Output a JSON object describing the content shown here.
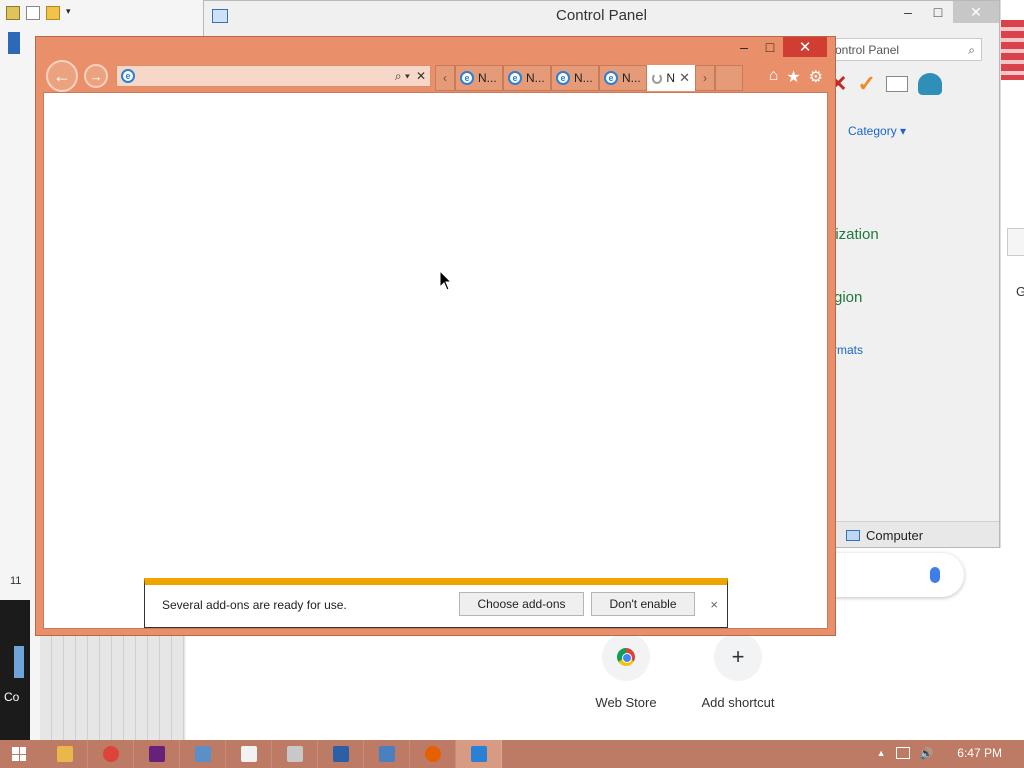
{
  "explorer": {
    "side_number": "11",
    "side_label": "Co"
  },
  "control_panel": {
    "title": "Control Panel",
    "search_placeholder": "ontrol Panel",
    "view_by": "Category",
    "links": [
      "lization",
      "gion",
      "rmats"
    ],
    "status_location": "Computer",
    "window_controls": {
      "minimize": "–",
      "maximize": "□",
      "close": "✕"
    }
  },
  "right_fragment": {
    "letter": "G"
  },
  "chrome_ntp": {
    "shortcuts": [
      {
        "label": "Web Store",
        "icon": "web-store-icon"
      },
      {
        "label": "Add shortcut",
        "icon": "plus-icon",
        "glyph": "+"
      }
    ]
  },
  "ie": {
    "window_controls": {
      "minimize": "–",
      "maximize": "□",
      "close": "✕"
    },
    "nav": {
      "back": "←",
      "forward": "→"
    },
    "address": {
      "value": "",
      "search_glyph": "⌕ ▾",
      "stop_glyph": "✕"
    },
    "tabs": [
      {
        "label": "N...",
        "icon": "ie-icon"
      },
      {
        "label": "N...",
        "icon": "ie-icon"
      },
      {
        "label": "N...",
        "icon": "ie-icon"
      },
      {
        "label": "N...",
        "icon": "ie-icon"
      },
      {
        "label": "N",
        "icon": "loading-icon",
        "active": true
      }
    ],
    "tab_scroll_left": "‹",
    "tab_scroll_right": "›",
    "tab_close": "✕",
    "commands": {
      "home": "⌂",
      "favorites": "★",
      "tools": "⚙"
    }
  },
  "notification": {
    "message": "Several add-ons are ready for use.",
    "choose_label": "Choose add-ons",
    "dont_enable_label": "Don't enable",
    "close_glyph": "×"
  },
  "taskbar": {
    "apps": [
      {
        "name": "file-explorer-icon",
        "color": "#e8b94a"
      },
      {
        "name": "chrome-icon",
        "color": "#db4437"
      },
      {
        "name": "visual-studio-icon",
        "color": "#68217a"
      },
      {
        "name": "performance-monitor-icon",
        "color": "#5a8fc7"
      },
      {
        "name": "document-icon",
        "color": "#f2f2f2"
      },
      {
        "name": "eraser-tool-icon",
        "color": "#c8c8c8"
      },
      {
        "name": "monitor-app-icon",
        "color": "#2b5fa8"
      },
      {
        "name": "control-panel-icon",
        "color": "#4a7fc0"
      },
      {
        "name": "firefox-icon",
        "color": "#e66000"
      },
      {
        "name": "internet-explorer-icon",
        "color": "#2b7fd4",
        "active": true
      }
    ],
    "clock": "6:47 PM",
    "tray_up": "▲",
    "volume_glyph": "🔊"
  },
  "colors": {
    "ie_frame": "#e9906a",
    "taskbar": "#bd7a64",
    "notification_accent": "#f0a400",
    "close_red": "#cf3d33"
  }
}
